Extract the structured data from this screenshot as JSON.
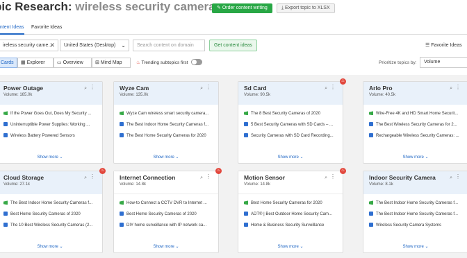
{
  "header": {
    "title_prefix": "pic Research:",
    "keyword": "wireless security cameras",
    "order_button": "Order content writing",
    "export_button": "Export topic to XLSX"
  },
  "tabs": [
    {
      "label": "ontent Ideas",
      "active": true
    },
    {
      "label": "Favorite Ideas",
      "active": false
    }
  ],
  "search": {
    "keyword_value": "ireless security came...",
    "clear_icon": "close-icon",
    "location_value": "United States (Desktop)",
    "domain_placeholder": "Search content on domain",
    "get_button": "Get content ideas",
    "favorite_ideas": "Favorite Ideas"
  },
  "views": {
    "cards": "Cards",
    "explorer": "Explorer",
    "overview": "Overview",
    "mindmap": "Mind Map",
    "trending": "Trending subtopics first",
    "trending_on": false,
    "prioritize_label": "Prioritize topics by:",
    "prioritize_value": "Volume"
  },
  "cards": [
    {
      "title": "Power Outage",
      "volume": "Volume: 165.0k",
      "hot": false,
      "highlight": true,
      "items": [
        {
          "icon": "g",
          "text": "If the Power Goes Out, Does My Security ..."
        },
        {
          "icon": "b",
          "text": "Uninterruptible Power Supplies: Working ..."
        },
        {
          "icon": "b",
          "text": "Wireless Battery Powered Sensors"
        }
      ]
    },
    {
      "title": "Wyze Cam",
      "volume": "Volume: 135.0k",
      "hot": false,
      "highlight": true,
      "items": [
        {
          "icon": "g",
          "text": "Wyze Cam wireless smart security camera..."
        },
        {
          "icon": "b",
          "text": "The Best Indoor Home Security Cameras f..."
        },
        {
          "icon": "b",
          "text": "The Best Home Security Cameras for 2020"
        }
      ]
    },
    {
      "title": "Sd Card",
      "volume": "Volume: 90.5k",
      "hot": true,
      "highlight": true,
      "items": [
        {
          "icon": "g",
          "text": "The 8 Best Security Cameras of 2020"
        },
        {
          "icon": "b",
          "text": "5 Best Security Cameras with SD Cards – ..."
        },
        {
          "icon": "b",
          "text": "Security Cameras with SD Card Recording..."
        }
      ]
    },
    {
      "title": "Arlo Pro",
      "volume": "Volume: 40.5k",
      "hot": false,
      "highlight": true,
      "items": [
        {
          "icon": "g",
          "text": "Wire-Free 4K and HD Smart Home Securit..."
        },
        {
          "icon": "b",
          "text": "The Best Wireless Security Cameras for 2..."
        },
        {
          "icon": "b",
          "text": "Rechargeable Wireless Security Cameras: ..."
        }
      ]
    },
    {
      "title": "Cloud Storage",
      "volume": "Volume: 27.1k",
      "hot": true,
      "highlight": true,
      "items": [
        {
          "icon": "g",
          "text": "The Best Indoor Home Security Cameras f..."
        },
        {
          "icon": "b",
          "text": "Best Home Security Cameras of 2020"
        },
        {
          "icon": "b",
          "text": "The 10 Best Wireless Security Cameras (2..."
        }
      ]
    },
    {
      "title": "Internet Connection",
      "volume": "Volume: 14.8k",
      "hot": true,
      "highlight": false,
      "items": [
        {
          "icon": "g",
          "text": "How-to Connect a CCTV DVR to Internet ..."
        },
        {
          "icon": "b",
          "text": "Best Home Security Cameras of 2020"
        },
        {
          "icon": "b",
          "text": "DIY home surveillance with IP network ca..."
        }
      ]
    },
    {
      "title": "Motion Sensor",
      "volume": "Volume: 14.8k",
      "hot": true,
      "highlight": false,
      "items": [
        {
          "icon": "g",
          "text": "Best Home Security Cameras for 2020"
        },
        {
          "icon": "b",
          "text": "ADT® | Best Outdoor Home Security Cam..."
        },
        {
          "icon": "b",
          "text": "Home & Business Security Surveillance"
        }
      ]
    },
    {
      "title": "Indoor Security Camera",
      "volume": "Volume: 8.1k",
      "hot": false,
      "highlight": true,
      "items": [
        {
          "icon": "g",
          "text": "The Best Indoor Home Security Cameras f..."
        },
        {
          "icon": "b",
          "text": "The Best Indoor Home Security Cameras f..."
        },
        {
          "icon": "b",
          "text": "Wireless Security Camera Systems"
        }
      ]
    }
  ],
  "show_more": "Show more",
  "colors": {
    "accent": "#1f66c4",
    "green": "#28a745",
    "hot": "#e2473c"
  }
}
